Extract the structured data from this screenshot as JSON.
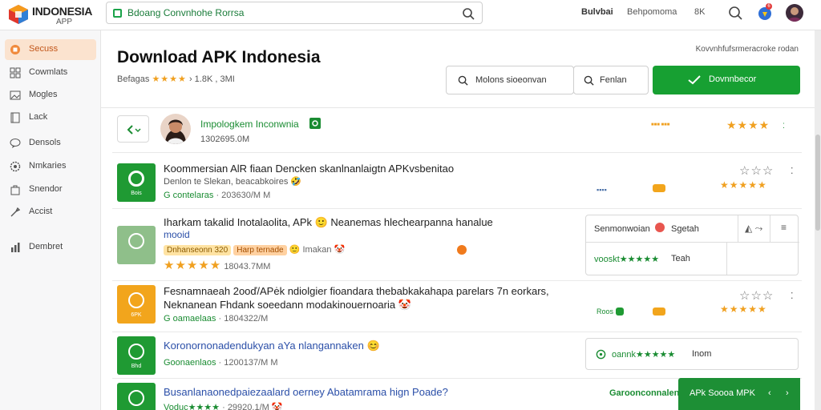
{
  "header": {
    "logo_title": "INDONESIA",
    "logo_sub": "APP",
    "search_value": "Bdoang Convnhohe Rorrsa",
    "nav": [
      "Bulvbai",
      "Behpomoma",
      "8K"
    ],
    "notif_count": "6"
  },
  "sidebar": {
    "items": [
      {
        "label": "Secuss",
        "icon": "home-icon",
        "active": true
      },
      {
        "label": "Cowmlats",
        "icon": "grid-icon"
      },
      {
        "label": "Mogles",
        "icon": "image-icon"
      },
      {
        "label": "Lack",
        "icon": "book-icon"
      },
      {
        "label": "Densols",
        "icon": "chat-icon"
      },
      {
        "label": "Nmkaries",
        "icon": "gear-icon"
      },
      {
        "label": "Snendor",
        "icon": "bag-icon"
      },
      {
        "label": "Accist",
        "icon": "tool-icon"
      },
      {
        "label": "Dembret",
        "icon": "chart-icon"
      }
    ]
  },
  "page": {
    "title": "Download APK Indonesia",
    "meta_prefix": "Befagas",
    "meta_rating": "★★★★",
    "meta_suffix": "› 1.8K , 3MI",
    "right_caption": "Kovvnhfufsrmeracroke rodan",
    "search_btn": "Molons sioeonvan",
    "filter_btn": "Fenlan",
    "download_btn": "Dovnnbecor"
  },
  "featured": {
    "name": "Impologkem Inconwnia",
    "size": "1302695.0M",
    "dots": "■■■ ■■■",
    "rating": "★★★★"
  },
  "rows": [
    {
      "title": "Koommersian AlR fiaan Dencken skanlnanlaigtn APKvsbenitao",
      "sub": "Denlon te Slekan, beacabkoires 🤣",
      "meta_green": "G contelaras",
      "meta": "· 203630/M M",
      "icon_sub": "Bois",
      "icon_color": "#1f9a33",
      "stars": "★★★★★",
      "stars_outline": "☆☆☆"
    },
    {
      "title": "Iharkam takalid Inotalaolita, APk 🙂 Neanemas hlechearpanna hanalue",
      "title2": "mooid",
      "tag1": "Dnhanseonn 320",
      "tag2": "Harp ternade",
      "extra": "🙂 Imakan 🤡",
      "stars": "★★★★★",
      "meta": "18043.7MM",
      "icon_color": "#8fbf8a",
      "panel_row1": "Senmonwoian",
      "panel_row1b": "Sgetah",
      "panel_row2": "vooskt★★★★★",
      "panel_row2b": "Teah"
    },
    {
      "title": "Fesnamnaeah 2ooď/APėk ndiolgier fioandara thebabkakahapa parelars 7n eorkars,",
      "title2": "Neknanean Fhdank soeedann modakinouernoaria 🤡",
      "meta_green": "G oamaelaas",
      "meta": "· 1804322/M",
      "icon_sub": "6PK",
      "icon_color": "#f2a51c",
      "stars": "★★★★★",
      "stars_outline": "☆☆☆",
      "right_tag": "Roos"
    },
    {
      "title": "Koronornonadendukyan aYa nlangannaken 😊",
      "meta_green": "Goonaenlaos",
      "meta": "· 1200137/M M",
      "icon_sub": "Bhd",
      "icon_color": "#1f9a33",
      "panel": "oannk★★★★★",
      "panel_b": "Inom"
    },
    {
      "title": "Busanlanaonedpaiezaalard oerney Abatamrama hign Poade?",
      "meta_green": "Voduc★★★★",
      "meta": "· 29920.1/M 🤡",
      "icon_color": "#1f9a33",
      "right_green": "Garoonconnalentkesoer",
      "toast": "APk Soooa MPK"
    }
  ],
  "colors": {
    "accent": "#17a032",
    "star": "#f0a020",
    "active_bg": "#fbe3cf"
  }
}
